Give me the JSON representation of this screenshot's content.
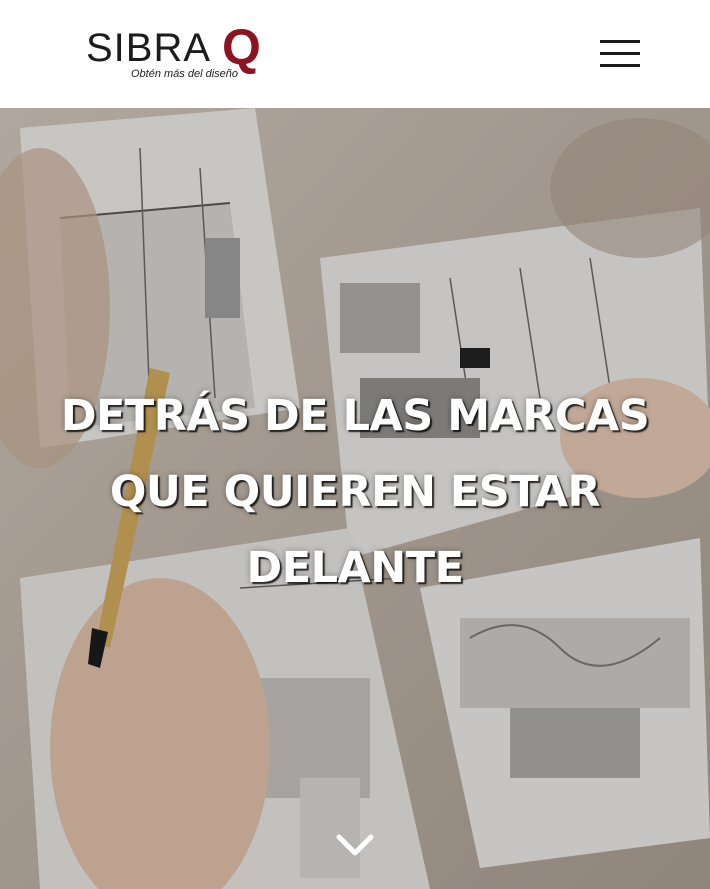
{
  "header": {
    "logo_word": "SIBRA",
    "logo_accent": "Q",
    "logo_tagline": "Obtén más del diseño",
    "menu_icon": "hamburger-menu-icon"
  },
  "hero": {
    "title_lines": [
      "DETRÁS DE LAS MARCAS",
      "QUE QUIEREN ESTAR",
      "DELANTE"
    ],
    "scroll_icon": "chevron-down-icon",
    "background": "photo of hands drawing interior sketches on paper"
  },
  "colors": {
    "brand_red": "#8d1320",
    "text_dark": "#1c1c1c",
    "hero_text": "#ffffff"
  }
}
